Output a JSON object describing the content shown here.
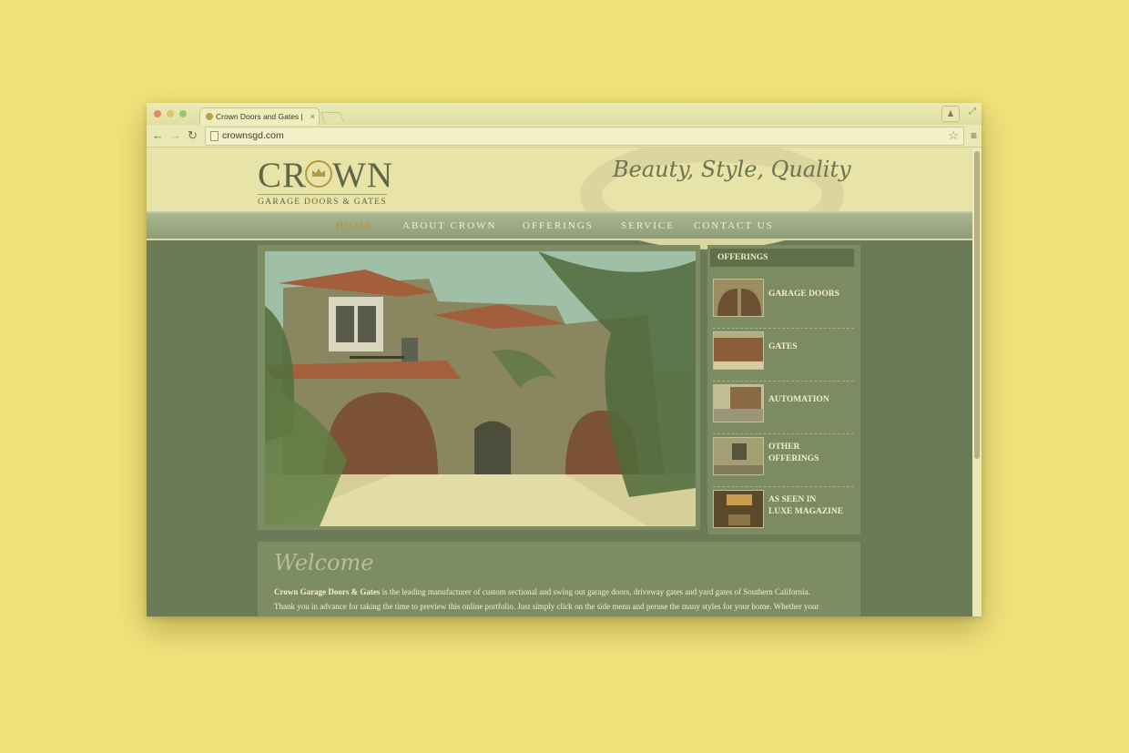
{
  "browser": {
    "tab_title": "Crown Doors and Gates | C",
    "tab_close": "×",
    "url": "crownsgd.com",
    "back_icon": "←",
    "forward_icon": "→",
    "reload_icon": "↻",
    "star_icon": "☆",
    "menu_icon": "≡",
    "profile_icon": "♟",
    "fullscreen_icon": "⤢"
  },
  "site": {
    "logo_text": "CR WN",
    "logo_subtitle": "GARAGE DOORS & GATES",
    "tagline": "Beauty, Style, Quality",
    "nav": [
      {
        "label": "HOME",
        "active": true
      },
      {
        "label": "ABOUT CROWN"
      },
      {
        "label": "OFFERINGS"
      },
      {
        "label": "SERVICE"
      },
      {
        "label": "CONTACT US"
      }
    ],
    "sidebar": {
      "title": "OFFERINGS",
      "items": [
        {
          "line1": "GARAGE DOORS",
          "line2": ""
        },
        {
          "line1": "GATES",
          "line2": ""
        },
        {
          "line1": "AUTOMATION",
          "line2": ""
        },
        {
          "line1": "OTHER",
          "line2": "OFFERINGS"
        },
        {
          "line1": "AS SEEN IN",
          "line2": "LUXE MAGAZINE"
        }
      ]
    },
    "welcome": {
      "title": "Welcome",
      "company": "Crown Garage Doors & Gates",
      "p1_rest": " is the leading manufacturer of custom sectional and swing out garage doors, driveway gates and yard gates of Southern California.",
      "p2": "Thank you in advance for taking the time to preview this online portfolio. Just simply click on the side menu and peruse the many styles for your home. Whether your"
    }
  },
  "colors": {
    "background": "#f1e37a",
    "page_bg": "#6c7a58",
    "accent_gold": "#b98f3d",
    "logo_green": "#5d6848"
  }
}
